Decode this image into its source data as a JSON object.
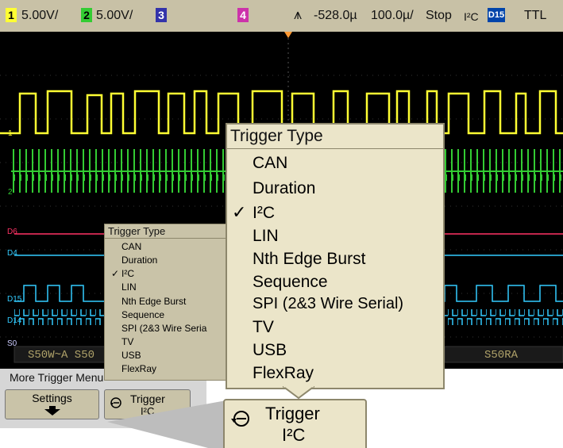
{
  "status": {
    "ch1_label": "1",
    "ch1_scale": "5.00V/",
    "ch2_label": "2",
    "ch2_scale": "5.00V/",
    "ch3_label": "3",
    "ch4_label": "4",
    "trigger_delay": "-528.0µ",
    "timebase": "100.0µ/",
    "run_state": "Stop",
    "trigger_source": "I²C",
    "digital_channel_label": "D15",
    "threshold": "TTL"
  },
  "channel_labels": {
    "ch1": "1",
    "ch2": "2",
    "d6": "D6",
    "d4": "D4",
    "d15": "D15",
    "d14": "D14",
    "s0": "S0"
  },
  "decode": {
    "left": "S50W~A S50",
    "right": "S50RA"
  },
  "softkeys": {
    "menu_title": "More Trigger Menu",
    "settings_label": "Settings",
    "trigger_label": "Trigger",
    "trigger_value": "I²C"
  },
  "trigger_type_menu": {
    "title": "Trigger Type",
    "selected": "I²C",
    "items": [
      {
        "label": "CAN"
      },
      {
        "label": "Duration"
      },
      {
        "label": "I²C"
      },
      {
        "label": "LIN"
      },
      {
        "label": "Nth Edge Burst"
      },
      {
        "label": "Sequence"
      },
      {
        "label": "SPI (2&3 Wire Serial)"
      },
      {
        "label": "TV"
      },
      {
        "label": "USB"
      },
      {
        "label": "FlexRay"
      }
    ]
  },
  "trigger_type_menu_small": {
    "title": "Trigger Type",
    "items": [
      {
        "label": "CAN"
      },
      {
        "label": "Duration"
      },
      {
        "label": "I²C"
      },
      {
        "label": "LIN"
      },
      {
        "label": "Nth Edge Burst"
      },
      {
        "label": "Sequence"
      },
      {
        "label": "SPI (2&3 Wire Seria"
      },
      {
        "label": "TV"
      },
      {
        "label": "USB"
      },
      {
        "label": "FlexRay"
      }
    ]
  },
  "colors": {
    "ch1": "#ffff33",
    "ch2": "#33cc33",
    "ch3": "#9999ff",
    "ch4": "#ff66cc",
    "digital": "#33ccff",
    "d6": "#ff3366",
    "menu_bg": "#c9c3a8"
  },
  "icons": {
    "trigger_softkey": "rotate-arrow-icon",
    "settings_softkey": "down-arrow-icon",
    "checkmark": "checkmark-icon"
  }
}
